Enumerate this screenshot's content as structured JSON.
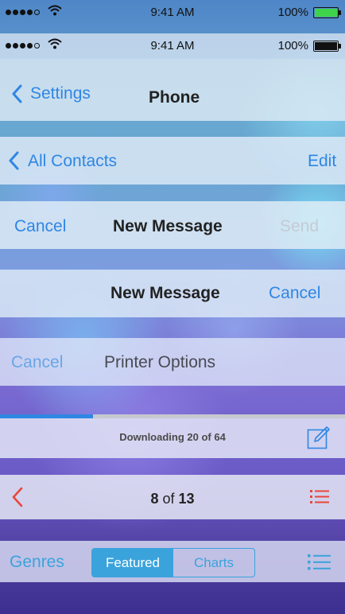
{
  "status_bar_1": {
    "time": "9:41 AM",
    "battery_pct": "100%",
    "signal_bars": 4,
    "battery_color": "#3fd34b"
  },
  "status_bar_2": {
    "time": "9:41 AM",
    "battery_pct": "100%",
    "signal_bars": 4
  },
  "nav_phone": {
    "back_label": "Settings",
    "title": "Phone"
  },
  "nav_contacts": {
    "back_label": "All Contacts",
    "action_label": "Edit"
  },
  "nav_new_message_1": {
    "left_label": "Cancel",
    "title": "New Message",
    "right_label": "Send"
  },
  "nav_new_message_2": {
    "title": "New Message",
    "right_label": "Cancel"
  },
  "nav_printer": {
    "left_label": "Cancel",
    "title": "Printer Options"
  },
  "download_bar": {
    "status_text": "Downloading 20 of 64",
    "progress": 0.27,
    "compose_icon": "compose-icon"
  },
  "pager_bar": {
    "current": "8",
    "of_label": "of",
    "total": "13",
    "back_icon": "chevron-left-icon",
    "list_icon": "list-icon"
  },
  "store_bar": {
    "left_label": "Genres",
    "segments": [
      "Featured",
      "Charts"
    ],
    "selected": "Featured",
    "list_icon": "list-icon"
  },
  "colors": {
    "ios_blue": "#2f86e4",
    "red_accent": "#e8473a",
    "segment_blue": "#3aa3dc",
    "disabled_gray": "#c4cbd3"
  }
}
